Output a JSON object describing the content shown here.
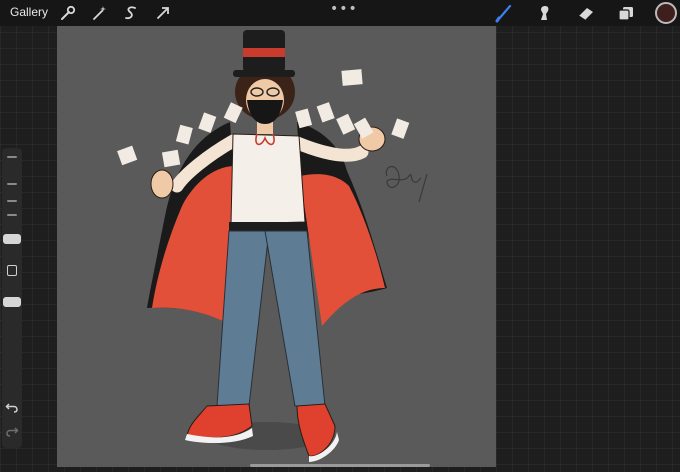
{
  "toolbar": {
    "gallery_label": "Gallery",
    "left_tools": [
      "wrench-icon",
      "magic-wand-icon",
      "selection-s-icon",
      "transform-arrow-icon"
    ],
    "right_tools": [
      "brush-icon",
      "smudge-icon",
      "eraser-icon",
      "layers-icon"
    ],
    "more_label": "•••",
    "active_tool": "brush",
    "active_color": "#3f1e1e",
    "brush_accent": "#3d7ff2"
  },
  "sidebar": {
    "brush_size_level": 0.3,
    "opacity_level": 0.5,
    "icons": [
      "modify-button-square",
      "undo-icon",
      "redo-icon"
    ]
  },
  "canvas": {
    "background": "#5a5a5a",
    "artwork": "magician-character-illustration",
    "cape_color": "#e2503a",
    "jeans_color": "#5e7d95",
    "hat_band_color": "#c93b2c"
  }
}
